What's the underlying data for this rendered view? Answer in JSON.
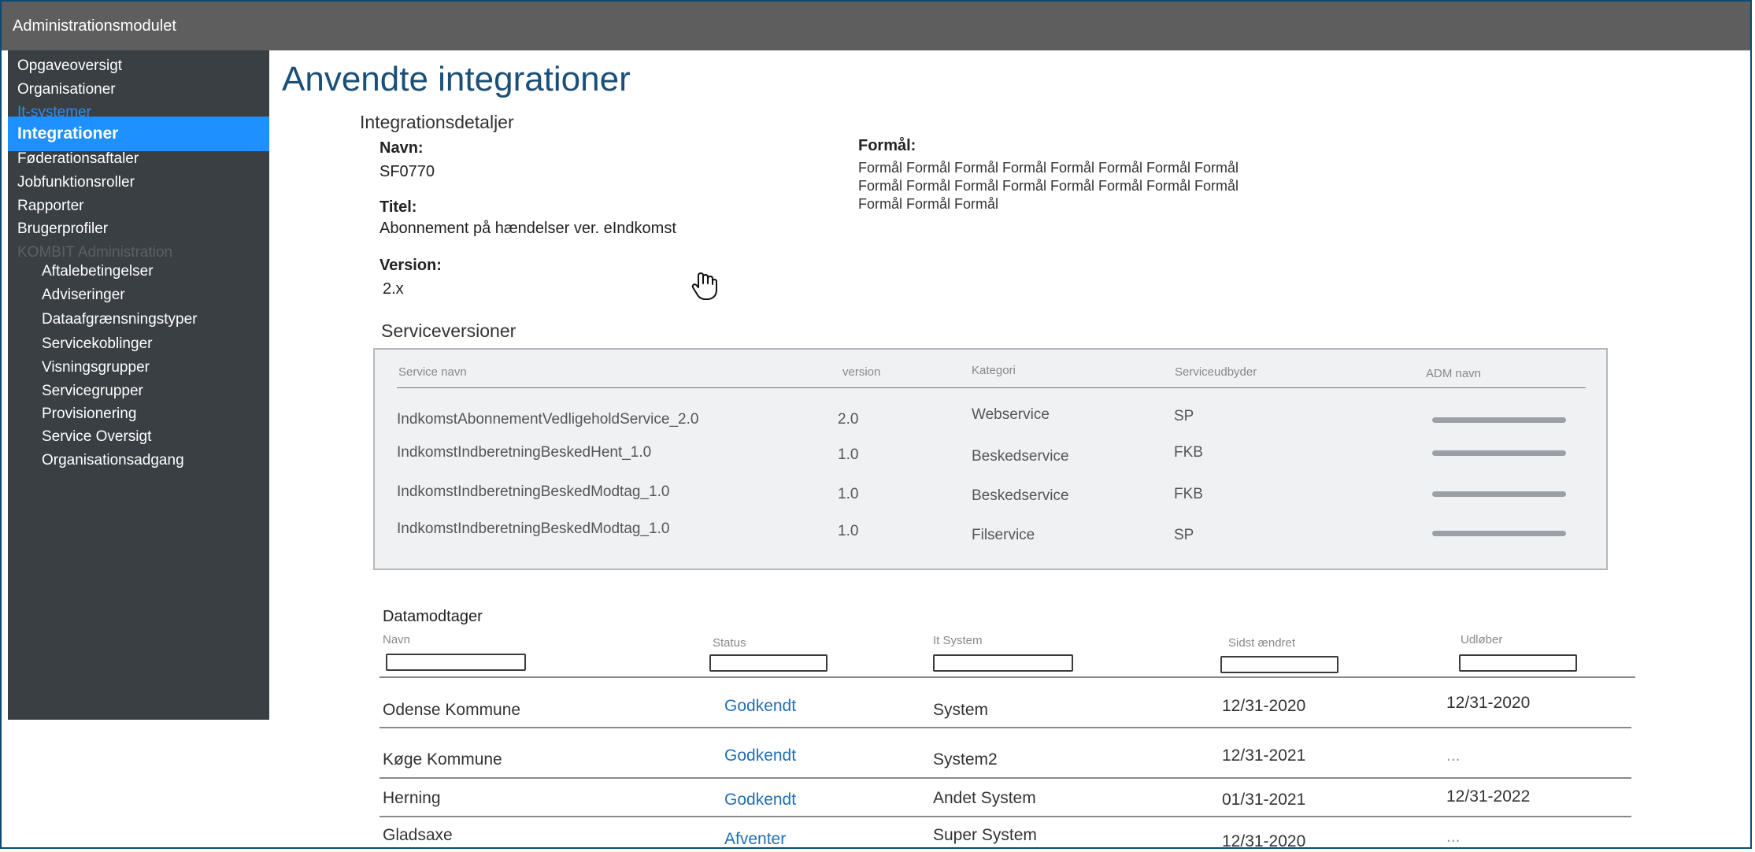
{
  "app": {
    "title": "Administrationsmodulet"
  },
  "sidebar": {
    "items": [
      {
        "label": "Opgaveoversigt"
      },
      {
        "label": "Organisationer"
      },
      {
        "label": "It-systemer"
      },
      {
        "label": "Integrationer",
        "active": true
      },
      {
        "label": "Føderationsaftaler"
      },
      {
        "label": "Jobfunktionsroller"
      },
      {
        "label": "Rapporter"
      },
      {
        "label": "Brugerprofiler"
      }
    ],
    "section_label": "KOMBIT Administration",
    "sub_items": [
      {
        "label": "Aftalebetingelser"
      },
      {
        "label": "Adviseringer"
      },
      {
        "label": "Dataafgrænsningstyper"
      },
      {
        "label": "Servicekoblinger"
      },
      {
        "label": "Visningsgrupper"
      },
      {
        "label": "Servicegrupper"
      },
      {
        "label": "Provisionering"
      },
      {
        "label": "Service Oversigt"
      },
      {
        "label": "Organisationsadgang"
      }
    ]
  },
  "page": {
    "title": "Anvendte integrationer",
    "details_heading": "Integrationsdetaljer",
    "name_label": "Navn:",
    "name_value": "SF0770",
    "title_label": "Titel:",
    "title_value": "Abonnement på hændelser ver. eIndkomst",
    "version_label": "Version:",
    "version_value": "2.x",
    "purpose_label": "Formål:",
    "purpose_text": "Formål Formål Formål Formål Formål Formål Formål Formål Formål Formål Formål Formål Formål Formål Formål Formål Formål Formål Formål"
  },
  "serviceversions": {
    "heading": "Serviceversioner",
    "columns": [
      "Service navn",
      "version",
      "Kategori",
      "Serviceudbyder",
      "ADM navn"
    ],
    "rows": [
      [
        "IndkomstAbonnementVedligeholdService_2.0",
        "2.0",
        "Webservice",
        "SP"
      ],
      [
        "IndkomstIndberetningBeskedHent_1.0",
        "1.0",
        "Beskedservice",
        "FKB"
      ],
      [
        "IndkomstIndberetningBeskedModtag_1.0",
        "1.0",
        "Beskedservice",
        "FKB"
      ],
      [
        "IndkomstIndberetningBeskedModtag_1.0",
        "1.0",
        "Filservice",
        "SP"
      ]
    ]
  },
  "datamodtager": {
    "heading": "Datamodtager",
    "columns": [
      "Navn",
      "Status",
      "It System",
      "Sidst ændret",
      "Udløber"
    ],
    "rows": [
      [
        "Odense Kommune",
        "Godkendt",
        "System",
        "12/31-2020",
        "12/31-2020"
      ],
      [
        "Køge Kommune",
        "Godkendt",
        "System2",
        "12/31-2021",
        "..."
      ],
      [
        "Herning",
        "Godkendt",
        "Andet System",
        "01/31-2021",
        "12/31-2022"
      ],
      [
        "Gladsaxe",
        "Afventer",
        "Super System",
        "12/31-2020",
        "..."
      ]
    ]
  },
  "colors": {
    "topbar": "#5e5e5e",
    "sidebar": "#3a3f44",
    "active_item": "#1e90ff",
    "link": "#2d8cf0",
    "title": "#1b4f78",
    "status": "#1f6fb5"
  },
  "icons": {
    "cursor": "hand-cursor-icon"
  }
}
